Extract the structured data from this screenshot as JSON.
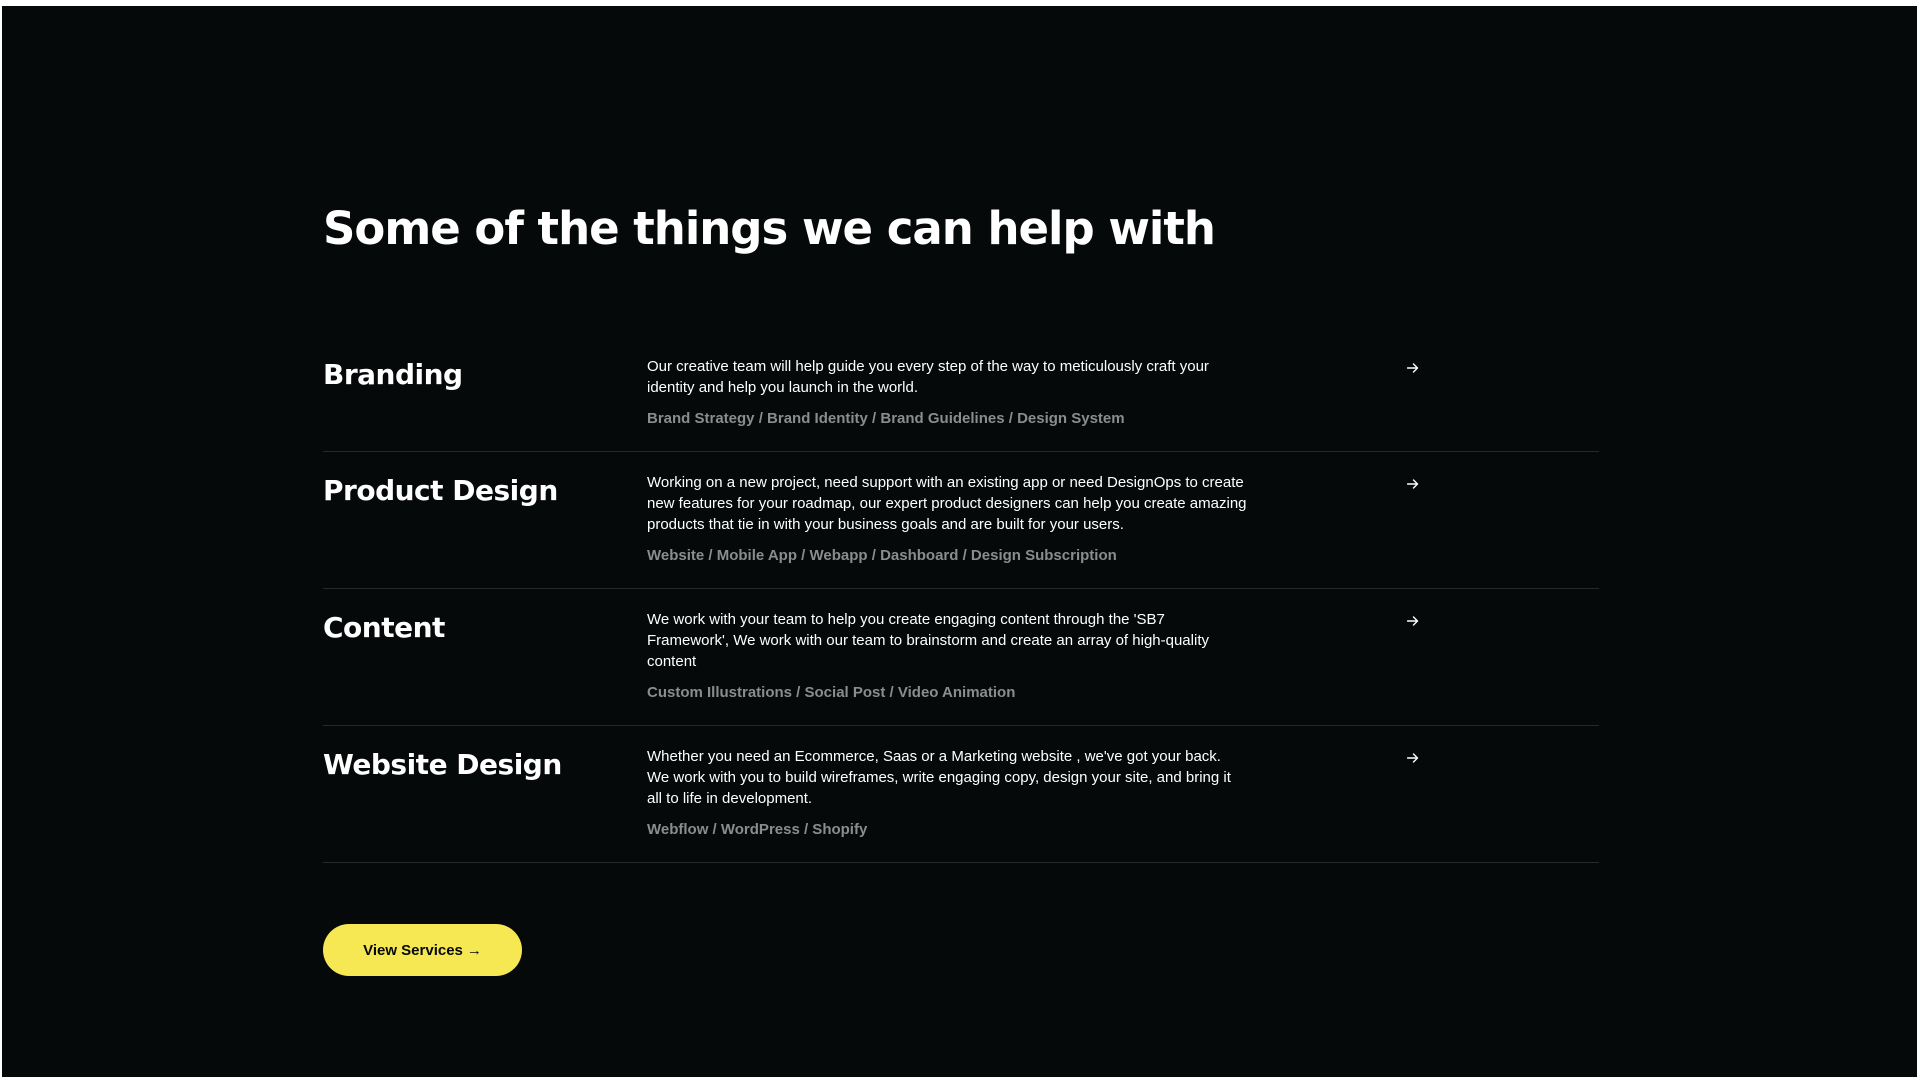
{
  "section": {
    "heading": "Some of the things we can help with"
  },
  "services": [
    {
      "title": "Branding",
      "description": "Our creative team will help guide you every step of the way to meticulously craft your identity and help you launch in the world.",
      "tags": "Brand Strategy / Brand Identity / Brand Guidelines / Design System",
      "icon": "arrow-right-icon"
    },
    {
      "title": "Product Design",
      "description": "Working on a new project, need support with an existing app or need DesignOps to create new features for your roadmap, our expert product designers can help you create amazing products that tie in with your business goals and are built for your users.",
      "tags": "Website / Mobile App / Webapp / Dashboard / Design Subscription",
      "icon": "arrow-right-icon"
    },
    {
      "title": "Content",
      "description": "We work with your team to help you create engaging content through the 'SB7 Framework', We work with our team to brainstorm and create an array of high-quality content",
      "tags": "Custom Illustrations / Social Post / Video Animation",
      "icon": "arrow-right-icon"
    },
    {
      "title": "Website Design",
      "description": "Whether you need an Ecommerce, Saas or a Marketing website , we've got your back. We work with you to build wireframes, write engaging copy, design your site, and bring it all to life in development.",
      "tags": "Webflow / WordPress / Shopify",
      "icon": "arrow-right-icon"
    }
  ],
  "cta": {
    "label": "View Services",
    "arrow": "→"
  },
  "colors": {
    "background": "#060909",
    "accent": "#f6e852",
    "text": "#ffffff",
    "muted": "#8a8d8f",
    "divider": "#26292b"
  }
}
